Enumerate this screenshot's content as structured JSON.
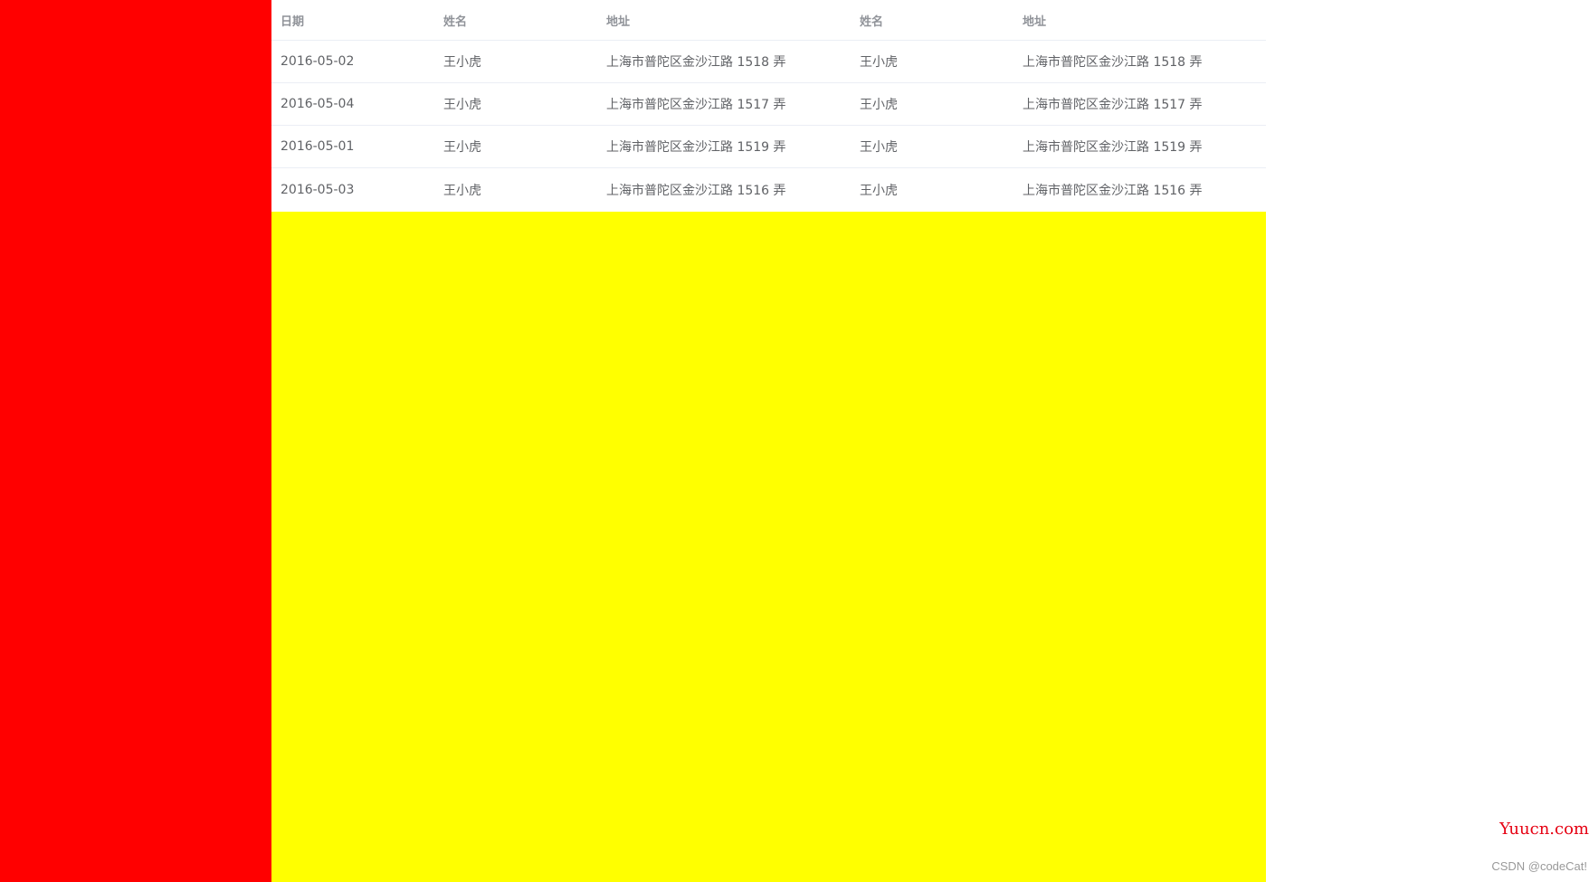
{
  "colors": {
    "sidebar": "#ff0000",
    "main": "#ffff00",
    "table_bg": "#ffffff",
    "watermark_red": "#e60012"
  },
  "table": {
    "headers": [
      "日期",
      "姓名",
      "地址",
      "姓名",
      "地址"
    ],
    "rows": [
      [
        "2016-05-02",
        "王小虎",
        "上海市普陀区金沙江路 1518 弄",
        "王小虎",
        "上海市普陀区金沙江路 1518 弄"
      ],
      [
        "2016-05-04",
        "王小虎",
        "上海市普陀区金沙江路 1517 弄",
        "王小虎",
        "上海市普陀区金沙江路 1517 弄"
      ],
      [
        "2016-05-01",
        "王小虎",
        "上海市普陀区金沙江路 1519 弄",
        "王小虎",
        "上海市普陀区金沙江路 1519 弄"
      ],
      [
        "2016-05-03",
        "王小虎",
        "上海市普陀区金沙江路 1516 弄",
        "王小虎",
        "上海市普陀区金沙江路 1516 弄"
      ]
    ]
  },
  "watermarks": {
    "logo": "Yuucn.com",
    "csdn": "CSDN @codeCat!"
  }
}
